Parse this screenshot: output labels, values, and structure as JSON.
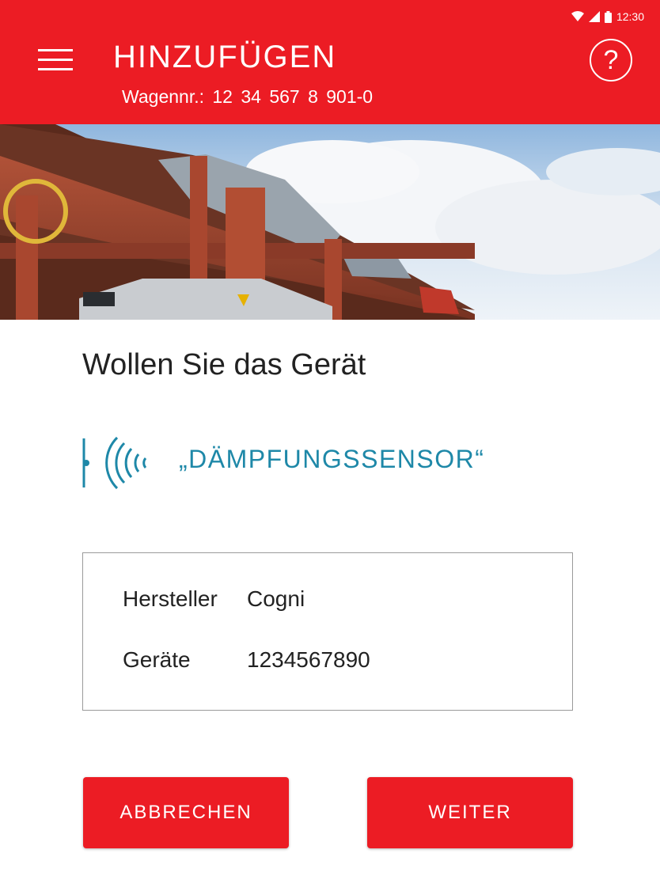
{
  "status_bar": {
    "time": "12:30"
  },
  "header": {
    "title": "HINZUFÜGEN",
    "wagon_number": "Wagennr.: 12 34 567 8 901-0",
    "help_label": "?"
  },
  "main": {
    "question": "Wollen Sie das Gerät",
    "sensor_name": "„DÄMPFUNGSSENSOR“",
    "details": [
      {
        "label": "Hersteller",
        "value": "Cogni"
      },
      {
        "label": "Geräte",
        "value": "1234567890"
      }
    ]
  },
  "buttons": {
    "cancel": "ABBRECHEN",
    "next": "WEITER"
  },
  "colors": {
    "brand": "#ec1c24",
    "sensor": "#1e88a8"
  }
}
